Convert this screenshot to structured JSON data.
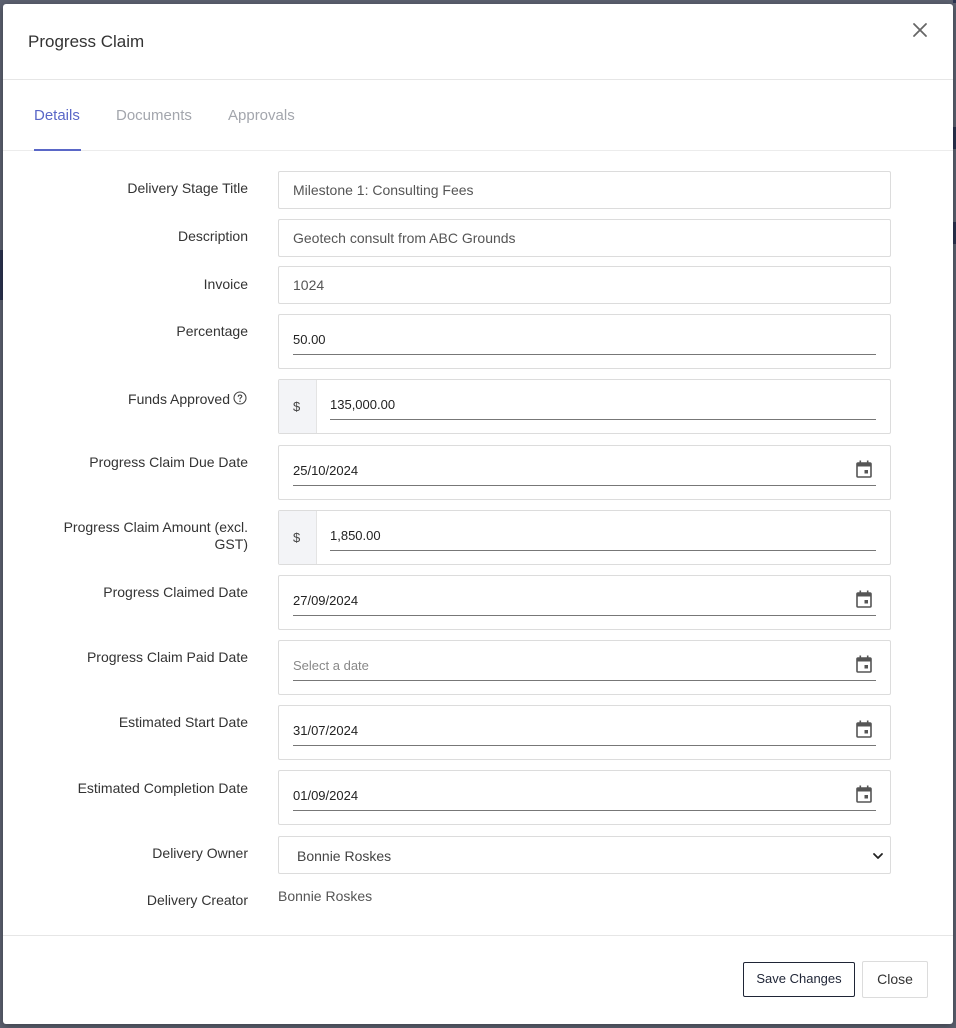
{
  "modal": {
    "title": "Progress Claim",
    "close_icon": "close-icon"
  },
  "tabs": [
    {
      "label": "Details",
      "active": true
    },
    {
      "label": "Documents",
      "active": false
    },
    {
      "label": "Approvals",
      "active": false
    }
  ],
  "form": {
    "delivery_stage_title": {
      "label": "Delivery Stage Title",
      "value": "Milestone 1: Consulting Fees"
    },
    "description": {
      "label": "Description",
      "value": "Geotech consult from ABC Grounds"
    },
    "invoice": {
      "label": "Invoice",
      "value": "1024"
    },
    "percentage": {
      "label": "Percentage",
      "value": "50.00"
    },
    "funds_approved": {
      "label": "Funds Approved",
      "prefix": "$",
      "value": "135,000.00",
      "help_icon": "help-circle-icon"
    },
    "progress_claim_due_date": {
      "label": "Progress Claim Due Date",
      "value": "25/10/2024"
    },
    "progress_claim_amount": {
      "label_line1": "Progress Claim Amount (excl.",
      "label_line2": "GST)",
      "prefix": "$",
      "value": "1,850.00"
    },
    "progress_claimed_date": {
      "label": "Progress Claimed Date",
      "value": "27/09/2024"
    },
    "progress_claim_paid_date": {
      "label": "Progress Claim Paid Date",
      "placeholder": "Select a date"
    },
    "estimated_start_date": {
      "label": "Estimated Start Date",
      "value": "31/07/2024"
    },
    "estimated_completion_date": {
      "label": "Estimated Completion Date",
      "value": "01/09/2024"
    },
    "delivery_owner": {
      "label": "Delivery Owner",
      "value": "Bonnie Roskes"
    },
    "delivery_creator": {
      "label": "Delivery Creator",
      "value": "Bonnie Roskes"
    }
  },
  "footer": {
    "save_label": "Save Changes",
    "close_label": "Close"
  },
  "colors": {
    "accent": "#5a67c7",
    "tab_inactive": "#a3a6ad",
    "save_border": "#1f2536"
  }
}
